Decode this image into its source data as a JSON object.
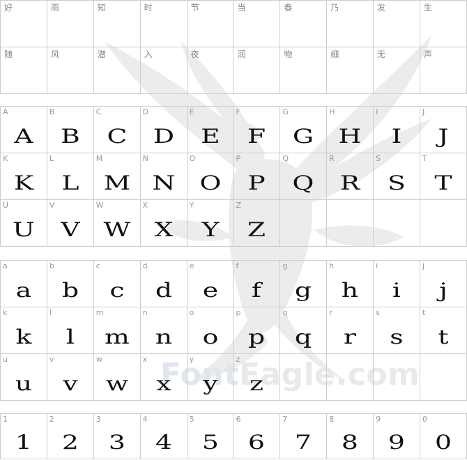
{
  "watermark": {
    "brand_part1": "Font",
    "brand_part2": "Eagle.com"
  },
  "cjk_rows": [
    [
      "好",
      "雨",
      "知",
      "时",
      "节",
      "当",
      "春",
      "乃",
      "发",
      "生"
    ],
    [
      "随",
      "风",
      "潜",
      "入",
      "夜",
      "润",
      "物",
      "细",
      "无",
      "声"
    ]
  ],
  "upper_rows": [
    [
      "A",
      "B",
      "C",
      "D",
      "E",
      "F",
      "G",
      "H",
      "I",
      "J"
    ],
    [
      "K",
      "L",
      "M",
      "N",
      "O",
      "P",
      "Q",
      "R",
      "S",
      "T"
    ],
    [
      "U",
      "V",
      "W",
      "X",
      "Y",
      "Z"
    ]
  ],
  "lower_rows": [
    [
      "a",
      "b",
      "c",
      "d",
      "e",
      "f",
      "g",
      "h",
      "i",
      "j"
    ],
    [
      "k",
      "l",
      "m",
      "n",
      "o",
      "p",
      "q",
      "r",
      "s",
      "t"
    ],
    [
      "u",
      "v",
      "w",
      "x",
      "y",
      "z"
    ]
  ],
  "digit_rows": [
    [
      "1",
      "2",
      "3",
      "4",
      "5",
      "6",
      "7",
      "8",
      "9",
      "0"
    ]
  ]
}
